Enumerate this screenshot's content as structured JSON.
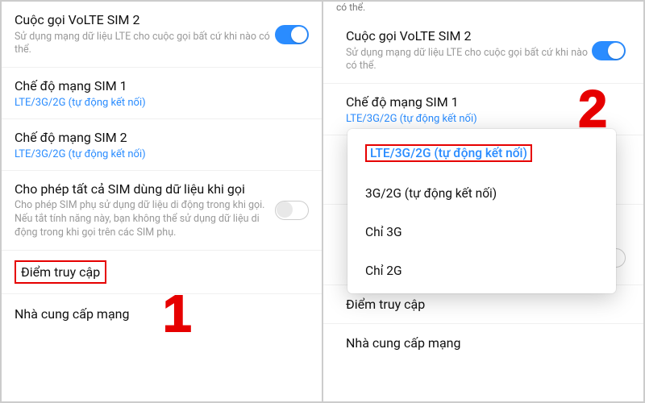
{
  "left": {
    "volte": {
      "title": "Cuộc gọi VoLTE SIM 2",
      "subtitle": "Sử dụng mạng dữ liệu LTE cho cuộc gọi bất cứ khi nào có thể.",
      "toggle": "on"
    },
    "mode_sim1": {
      "title": "Chế độ mạng SIM 1",
      "value": "LTE/3G/2G (tự động kết nối)"
    },
    "mode_sim2": {
      "title": "Chế độ mạng SIM 2",
      "value": "LTE/3G/2G (tự động kết nối)"
    },
    "allow_all_sim": {
      "title": "Cho phép tất cả SIM dùng dữ liệu khi gọi",
      "subtitle": "Cho phép SIM phụ sử dụng dữ liệu di động trong khi gọi. Nếu tắt tính năng này, bạn không thể sử dụng dữ liệu di động trong khi gọi trên các SIM phụ.",
      "toggle": "off"
    },
    "apn": {
      "title": "Điểm truy cập"
    },
    "provider": {
      "title": "Nhà cung cấp mạng"
    },
    "step": "1"
  },
  "right": {
    "cutoff": "có thể.",
    "volte": {
      "title": "Cuộc gọi VoLTE SIM 2",
      "subtitle": "Sử dụng mạng dữ liệu LTE cho cuộc gọi bất cứ khi nào có thể.",
      "toggle": "on"
    },
    "mode_sim1": {
      "title": "Chế độ mạng SIM 1",
      "value": "LTE/3G/2G (tự động kết nối)"
    },
    "allow_all_sim_toggle": "off",
    "apn": {
      "title": "Điểm truy cập"
    },
    "provider": {
      "title": "Nhà cung cấp mạng"
    },
    "popup": {
      "options": [
        "LTE/3G/2G (tự động kết nối)",
        "3G/2G (tự động kết nối)",
        "Chỉ 3G",
        "Chỉ 2G"
      ],
      "selected_index": 0
    },
    "step": "2"
  }
}
